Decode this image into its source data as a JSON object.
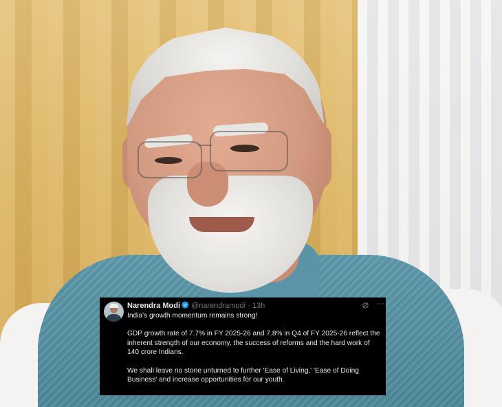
{
  "tweet": {
    "author_name": "Narendra Modi",
    "handle": "@narendramodi",
    "separator": "·",
    "time": "13h",
    "more_glyph": "···",
    "paragraphs": [
      "India's growth momentum remains strong!",
      "GDP growth rate of 7.7% in FY 2025-26 and 7.8% in Q4 of FY 2025-26 reflect the inherent strength of our economy, the success of reforms and the hard work of 140 crore Indians.",
      "We shall leave no stone unturned to further 'Ease of Living,' 'Ease of Doing Business' and increase opportunities for our youth."
    ],
    "colors": {
      "background": "#000000",
      "text": "#e7e9ea",
      "secondary_text": "#71767b",
      "verified_badge": "#1d9bf0"
    },
    "icons": {
      "verified": "verified-badge-icon",
      "grok": "grok-icon",
      "more": "more-icon"
    }
  }
}
